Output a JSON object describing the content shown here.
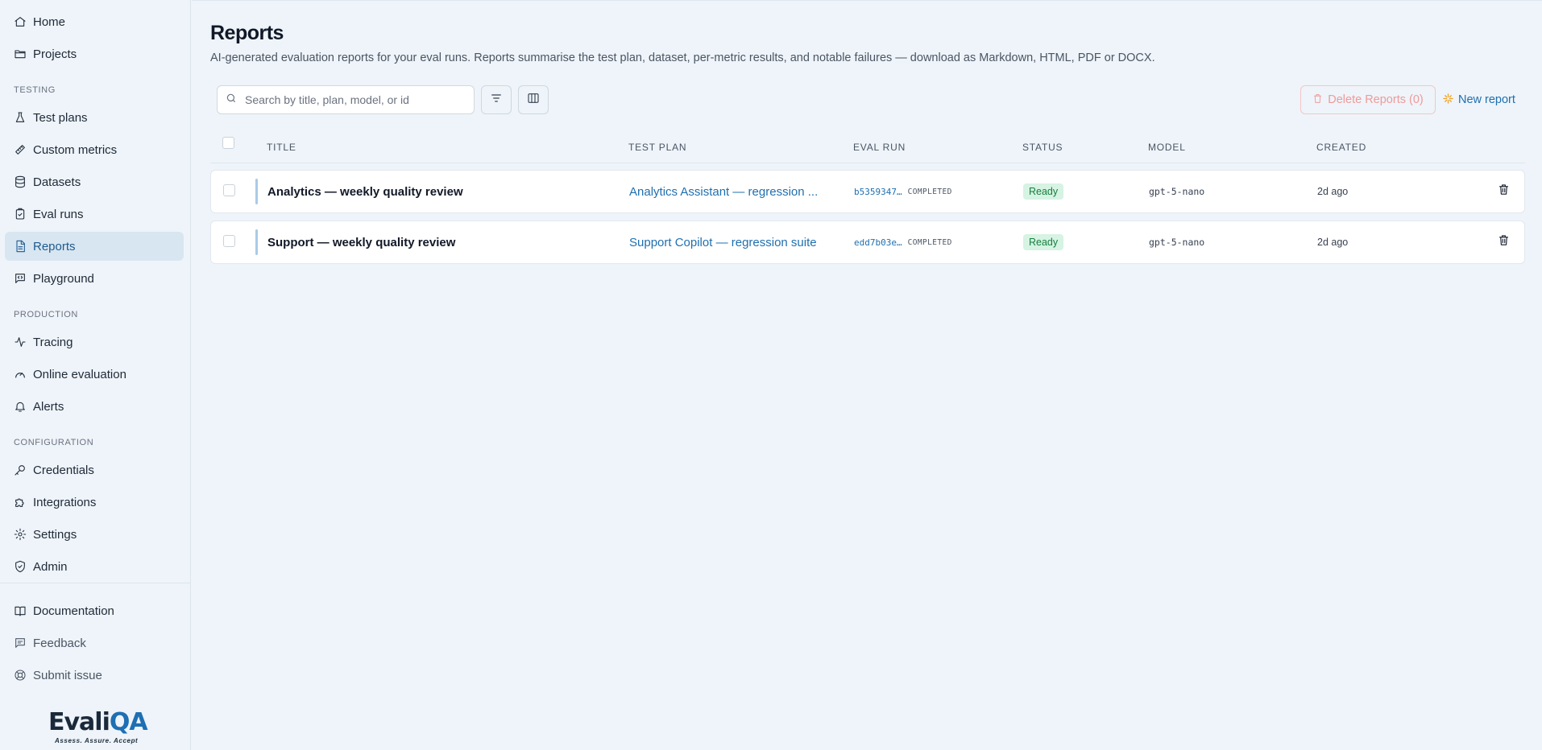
{
  "sidebar": {
    "nav": [
      {
        "label": "Home",
        "icon": "home-icon"
      },
      {
        "label": "Projects",
        "icon": "folder-icon"
      }
    ],
    "testing_title": "TESTING",
    "testing": [
      {
        "label": "Test plans",
        "icon": "flask-icon"
      },
      {
        "label": "Custom metrics",
        "icon": "ruler-icon"
      },
      {
        "label": "Datasets",
        "icon": "database-icon"
      },
      {
        "label": "Eval runs",
        "icon": "clipboard-check-icon"
      },
      {
        "label": "Reports",
        "icon": "file-text-icon",
        "active": true
      },
      {
        "label": "Playground",
        "icon": "message-code-icon"
      }
    ],
    "production_title": "PRODUCTION",
    "production": [
      {
        "label": "Tracing",
        "icon": "activity-icon"
      },
      {
        "label": "Online evaluation",
        "icon": "gauge-icon"
      },
      {
        "label": "Alerts",
        "icon": "bell-icon"
      }
    ],
    "configuration_title": "CONFIGURATION",
    "configuration": [
      {
        "label": "Credentials",
        "icon": "key-icon"
      },
      {
        "label": "Integrations",
        "icon": "puzzle-icon"
      },
      {
        "label": "Settings",
        "icon": "gear-icon"
      },
      {
        "label": "Admin",
        "icon": "shield-check-icon"
      }
    ],
    "footer": [
      {
        "label": "Documentation",
        "icon": "book-icon"
      },
      {
        "label": "Feedback",
        "icon": "message-icon"
      },
      {
        "label": "Submit issue",
        "icon": "lifebuoy-icon"
      }
    ],
    "logo": {
      "text_main": "Evali",
      "text_accent": "QA",
      "tagline": "Assess. Assure. Accept"
    }
  },
  "page": {
    "title": "Reports",
    "description": "AI-generated evaluation reports for your eval runs. Reports summarise the test plan, dataset, per-metric results, and notable failures — download as Markdown, HTML, PDF or DOCX."
  },
  "toolbar": {
    "search_placeholder": "Search by title, plan, model, or id",
    "delete_label": "Delete Reports (0)",
    "new_label": "New report"
  },
  "table": {
    "headers": {
      "title": "TITLE",
      "test_plan": "TEST PLAN",
      "eval_run": "EVAL RUN",
      "status": "STATUS",
      "model": "MODEL",
      "created": "CREATED"
    },
    "rows": [
      {
        "title": "Analytics — weekly quality review",
        "test_plan": "Analytics Assistant — regression ...",
        "run_id": "b5359347…",
        "run_status": "COMPLETED",
        "status": "Ready",
        "model": "gpt-5-nano",
        "created": "2d ago"
      },
      {
        "title": "Support — weekly quality review",
        "test_plan": "Support Copilot — regression suite",
        "run_id": "edd7b03e…",
        "run_status": "COMPLETED",
        "status": "Ready",
        "model": "gpt-5-nano",
        "created": "2d ago"
      }
    ]
  },
  "colors": {
    "accent": "#1f6fb0",
    "status_ready_bg": "#d6f3e3",
    "status_ready_text": "#15803d",
    "danger_disabled": "#ef9a9a",
    "new_report_icon": "#f0a020"
  }
}
